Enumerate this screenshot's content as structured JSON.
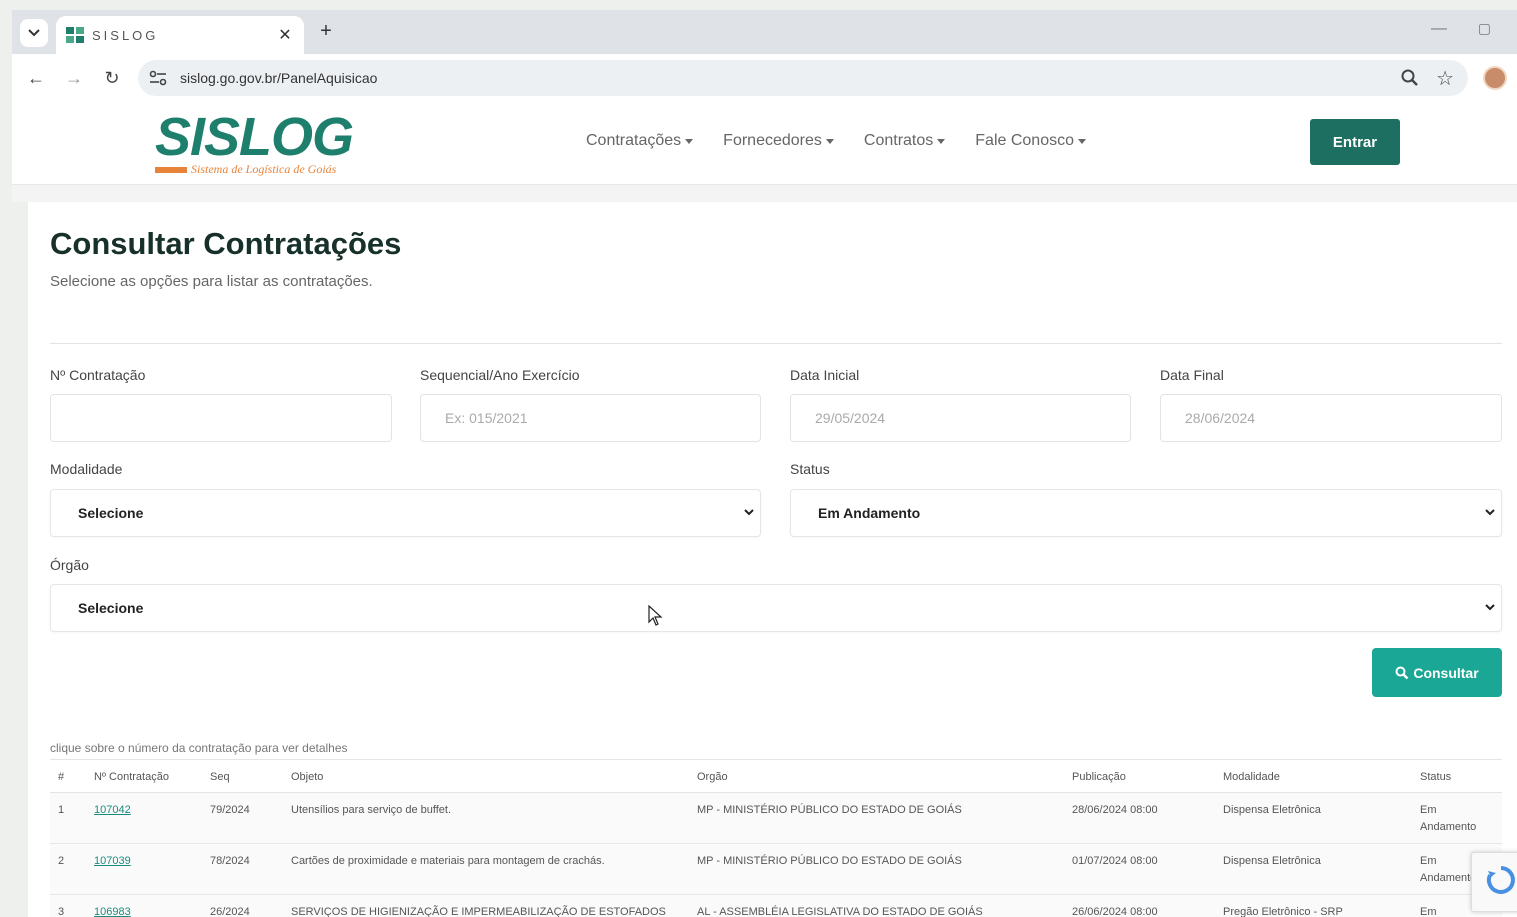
{
  "browser": {
    "tab_title": "SISLOG",
    "url": "sislog.go.gov.br/PanelAquisicao"
  },
  "header": {
    "logo_text": "SISLOG",
    "logo_subtitle": "Sistema de Logística de Goiás",
    "nav": [
      "Contratações",
      "Fornecedores",
      "Contratos",
      "Fale Conosco"
    ],
    "login_label": "Entrar"
  },
  "page": {
    "title": "Consultar Contratações",
    "subtitle": "Selecione as opções para listar as contratações."
  },
  "form": {
    "contratacao_label": "Nº Contratação",
    "contratacao_value": "",
    "sequencial_label": "Sequencial/Ano Exercício",
    "sequencial_placeholder": "Ex: 015/2021",
    "data_inicial_label": "Data Inicial",
    "data_inicial_value": "29/05/2024",
    "data_final_label": "Data Final",
    "data_final_value": "28/06/2024",
    "modalidade_label": "Modalidade",
    "modalidade_value": "Selecione",
    "status_label": "Status",
    "status_value": "Em Andamento",
    "orgao_label": "Órgão",
    "orgao_value": "Selecione",
    "consultar_label": "Consultar"
  },
  "results": {
    "hint": "clique sobre o número da contratação para ver detalhes",
    "columns": [
      "#",
      "Nº Contratação",
      "Seq",
      "Objeto",
      "Orgão",
      "Publicação",
      "Modalidade",
      "Status"
    ],
    "rows": [
      [
        "1",
        "107042",
        "79/2024",
        "Utensílios para serviço de buffet.",
        "MP - MINISTÉRIO PÚBLICO DO ESTADO DE GOIÁS",
        "28/06/2024 08:00",
        "Dispensa Eletrônica",
        "Em Andamento"
      ],
      [
        "2",
        "107039",
        "78/2024",
        "Cartões de proximidade e materiais para montagem de crachás.",
        "MP - MINISTÉRIO PÚBLICO DO ESTADO DE GOIÁS",
        "01/07/2024 08:00",
        "Dispensa Eletrônica",
        "Em Andamento"
      ],
      [
        "3",
        "106983",
        "26/2024",
        "SERVIÇOS DE HIGIENIZAÇÃO E IMPERMEABILIZAÇÃO DE ESTOFADOS",
        "AL - ASSEMBLÉIA LEGISLATIVA DO ESTADO DE GOIÁS",
        "26/06/2024 08:00",
        "Pregão Eletrônico - SRP",
        "Em"
      ]
    ]
  },
  "colors": {
    "brand": "#1d7f6c",
    "accent_orange": "#e8843a",
    "login_button": "#1d6f61",
    "search_button": "#1aa795"
  },
  "icons": [
    "tab-list-icon",
    "favicon-icon",
    "close-icon",
    "plus-icon",
    "minimize-icon",
    "maximize-icon",
    "back-icon",
    "forward-icon",
    "reload-icon",
    "site-settings-icon",
    "zoom-icon",
    "star-icon",
    "profile-icon",
    "caret-down-icon",
    "chevron-down-icon",
    "search-icon",
    "cursor-icon",
    "recaptcha-icon"
  ]
}
